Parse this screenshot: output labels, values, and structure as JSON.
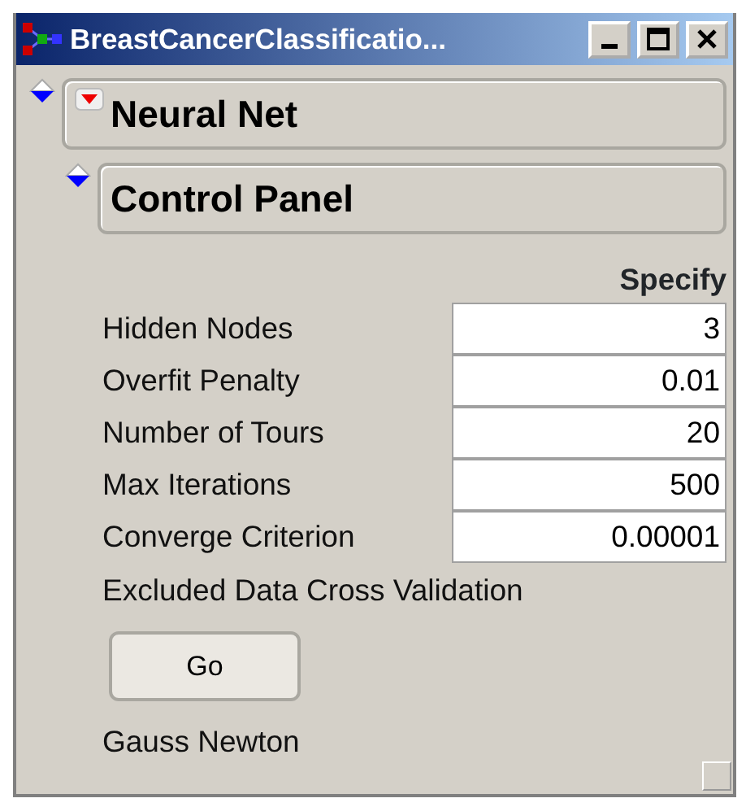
{
  "window": {
    "title": "BreastCancerClassificatio..."
  },
  "outline": {
    "title": "Neural Net",
    "expanded": true,
    "child": {
      "title": "Control Panel",
      "expanded": true,
      "column_header": "Specify",
      "fields": [
        {
          "label": "Hidden Nodes",
          "value": "3"
        },
        {
          "label": "Overfit Penalty",
          "value": "0.01"
        },
        {
          "label": "Number of Tours",
          "value": "20"
        },
        {
          "label": "Max Iterations",
          "value": "500"
        },
        {
          "label": "Converge Criterion",
          "value": "0.00001"
        }
      ],
      "note": "Excluded Data Cross Validation",
      "button": "Go",
      "method": "Gauss Newton"
    }
  }
}
